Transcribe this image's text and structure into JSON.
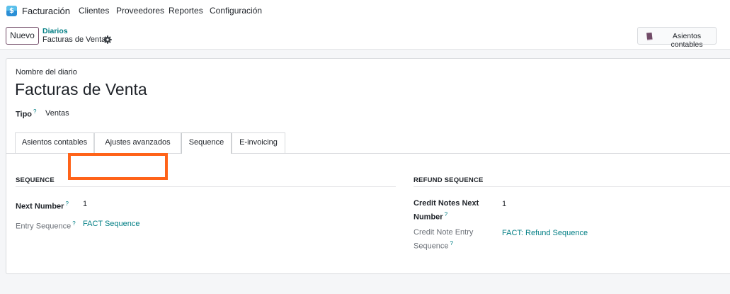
{
  "navbar": {
    "app_name": "Facturación",
    "menu": [
      "Clientes",
      "Proveedores",
      "Reportes",
      "Configuración"
    ]
  },
  "control_panel": {
    "new_button": "Nuevo",
    "breadcrumb_parent": "Diarios",
    "breadcrumb_current": "Facturas de Venta",
    "smart_button": "Asientos contables"
  },
  "form": {
    "name_caption": "Nombre del diario",
    "name": "Facturas de Venta",
    "type_label": "Tipo",
    "type_value": "Ventas",
    "help_mark": "?",
    "tabs": [
      "Asientos contables",
      "Ajustes avanzados",
      "Sequence",
      "E-invoicing"
    ],
    "active_tab": "Sequence",
    "sequence": {
      "title": "SEQUENCE",
      "next_number_label": "Next Number",
      "next_number_value": "1",
      "entry_sequence_label": "Entry Sequence",
      "entry_sequence_value": "FACT Sequence"
    },
    "refund_sequence": {
      "title": "REFUND SEQUENCE",
      "next_number_label_line1": "Credit Notes Next",
      "next_number_label_line2": "Number",
      "next_number_value": "1",
      "entry_label_line1": "Credit Note Entry",
      "entry_label_line2": "Sequence",
      "entry_value": "FACT: Refund Sequence"
    }
  },
  "colors": {
    "brand": "#714b67",
    "link": "#017e84",
    "highlight": "#ff6319"
  }
}
